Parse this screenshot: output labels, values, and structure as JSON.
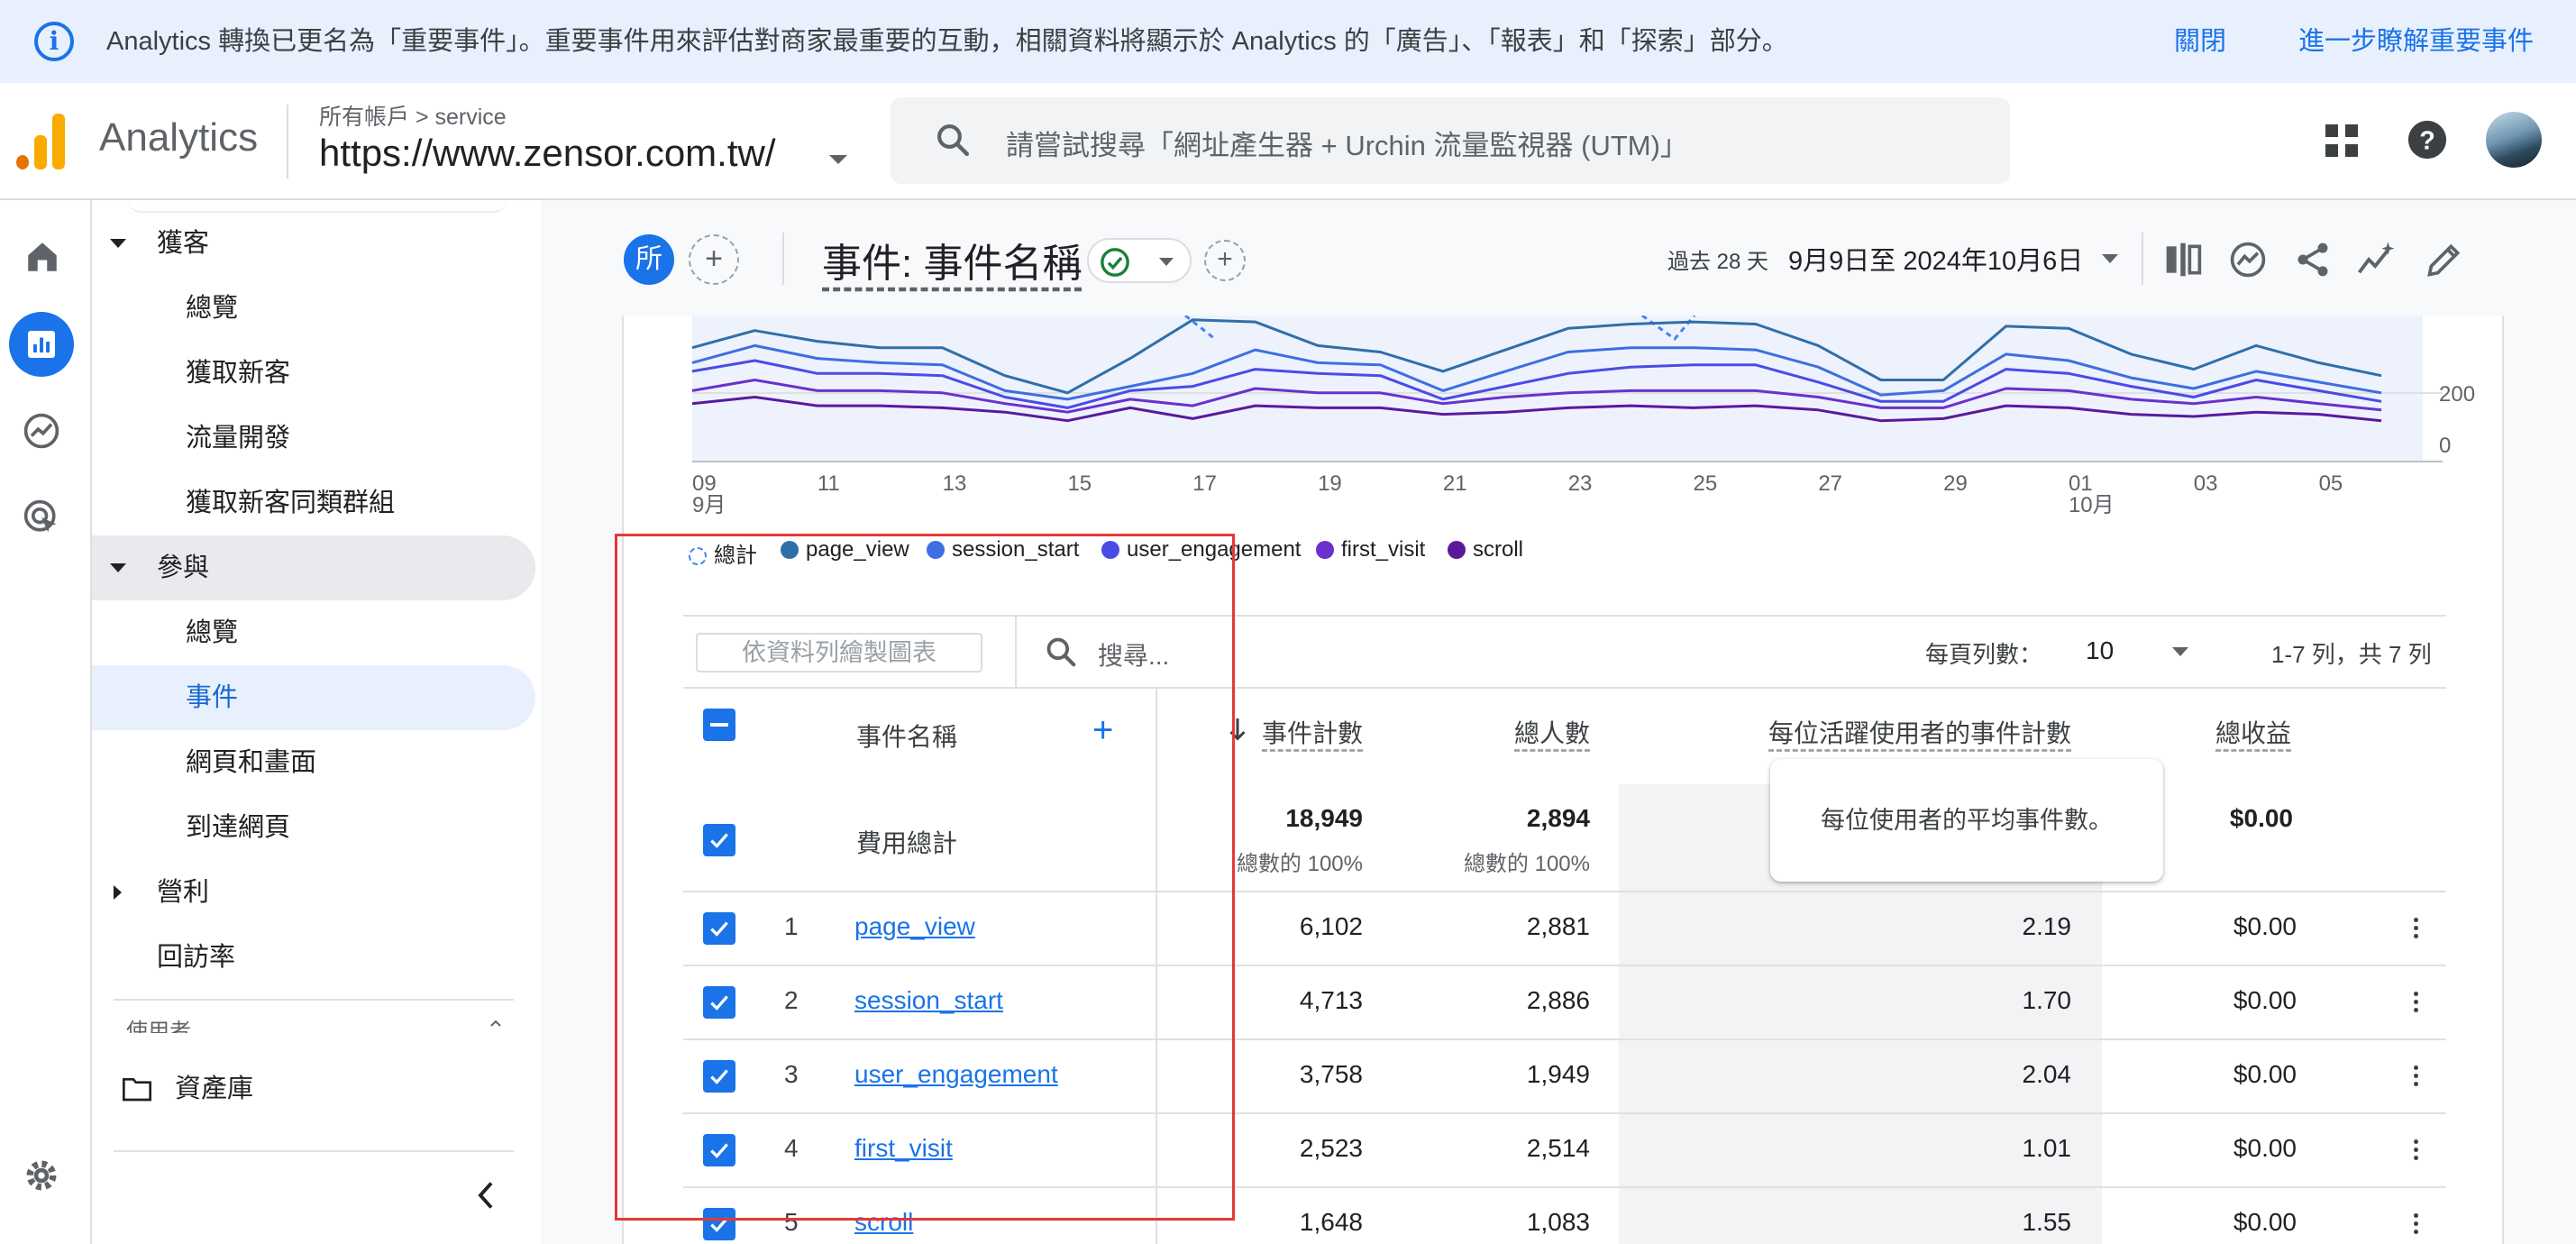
{
  "banner": {
    "message": "Analytics 轉換已更名為「重要事件」。重要事件用來評估對商家最重要的互動，相關資料將顯示於 Analytics 的「廣告」、「報表」和「探索」部分。",
    "close": "關閉",
    "learn_more": "進一步瞭解重要事件"
  },
  "header": {
    "app_name": "Analytics",
    "breadcrumb": "所有帳戶 > service",
    "property": "https://www.zensor.com.tw/",
    "search_placeholder": "請嘗試搜尋「網址產生器 + Urchin 流量監視器 (UTM)」"
  },
  "nav": {
    "acquisition": {
      "label": "獲客",
      "items": [
        "總覽",
        "獲取新客",
        "流量開發",
        "獲取新客同類群組"
      ]
    },
    "engagement": {
      "label": "參與",
      "items": [
        "總覽",
        "事件",
        "網頁和畫面",
        "到達網頁"
      ]
    },
    "monetization": "營利",
    "retention": "回訪率",
    "user_section": "使用者",
    "library": "資產庫"
  },
  "toolbar": {
    "avatar_letter": "所",
    "title": "事件: 事件名稱",
    "date_prefix": "過去 28 天",
    "date_range": "9月9日至 2024年10月6日"
  },
  "chart_data": {
    "type": "line",
    "x": [
      "09/09",
      "09/10",
      "09/11",
      "09/12",
      "09/13",
      "09/14",
      "09/15",
      "09/16",
      "09/17",
      "09/18",
      "09/19",
      "09/20",
      "09/21",
      "09/22",
      "09/23",
      "09/24",
      "09/25",
      "09/26",
      "09/27",
      "09/28",
      "09/29",
      "09/30",
      "10/01",
      "10/02",
      "10/03",
      "10/04",
      "10/05",
      "10/06"
    ],
    "x_tick_labels": [
      "09",
      "11",
      "13",
      "15",
      "17",
      "19",
      "21",
      "23",
      "25",
      "27",
      "29",
      "01",
      "03",
      "05"
    ],
    "x_month_labels": [
      "9月",
      "10月"
    ],
    "y_tick_labels": [
      "0",
      "200"
    ],
    "series": [
      {
        "name": "page_view",
        "color": "#2f6fa8",
        "values": [
          265,
          305,
          280,
          265,
          265,
          200,
          160,
          240,
          330,
          325,
          270,
          255,
          210,
          260,
          310,
          320,
          325,
          320,
          270,
          190,
          190,
          315,
          310,
          250,
          215,
          270,
          230,
          200
        ]
      },
      {
        "name": "session_start",
        "color": "#3d6fe0",
        "values": [
          230,
          270,
          240,
          230,
          225,
          165,
          145,
          175,
          205,
          260,
          230,
          225,
          165,
          210,
          255,
          265,
          265,
          260,
          220,
          155,
          165,
          250,
          235,
          195,
          170,
          210,
          185,
          160
        ]
      },
      {
        "name": "user_engagement",
        "color": "#4a4ce6",
        "values": [
          210,
          235,
          205,
          205,
          200,
          150,
          125,
          165,
          175,
          215,
          205,
          200,
          145,
          175,
          205,
          220,
          225,
          225,
          185,
          140,
          140,
          215,
          205,
          175,
          150,
          190,
          165,
          140
        ]
      },
      {
        "name": "first_visit",
        "color": "#6a31cc",
        "values": [
          165,
          190,
          165,
          165,
          160,
          135,
          115,
          145,
          130,
          170,
          160,
          160,
          135,
          150,
          160,
          165,
          165,
          165,
          150,
          125,
          125,
          170,
          165,
          145,
          135,
          150,
          135,
          120
        ]
      },
      {
        "name": "scroll",
        "color": "#5b1a9c",
        "values": [
          135,
          150,
          130,
          130,
          125,
          115,
          95,
          125,
          100,
          130,
          125,
          125,
          110,
          115,
          125,
          130,
          125,
          130,
          120,
          95,
          100,
          130,
          125,
          110,
          105,
          115,
          110,
          95
        ]
      }
    ]
  },
  "legend": [
    {
      "label": "總計",
      "color": "#4285f4",
      "style": "dashed"
    },
    {
      "label": "page_view",
      "color": "#2f6fa8"
    },
    {
      "label": "session_start",
      "color": "#3d6fe0"
    },
    {
      "label": "user_engagement",
      "color": "#4a4ce6"
    },
    {
      "label": "first_visit",
      "color": "#6a31cc"
    },
    {
      "label": "scroll",
      "color": "#5b1a9c"
    }
  ],
  "table": {
    "plot_rows_placeholder": "依資料列繪製圖表",
    "search_placeholder": "搜尋...",
    "rows_per_page_label": "每頁列數：",
    "rows_per_page": "10",
    "pagination": "1-7 列，共 7 列",
    "columns": [
      "事件名稱",
      "事件計數",
      "總人數",
      "每位活躍使用者的事件計數",
      "總收益"
    ],
    "tooltip": "每位使用者的平均事件數。",
    "totals": {
      "label": "費用總計",
      "event_count": "18,949",
      "event_count_sub": "總數的 100%",
      "total_users": "2,894",
      "total_users_sub": "總數的 100%",
      "revenue": "$0.00"
    },
    "rows": [
      {
        "idx": "1",
        "name": "page_view",
        "event_count": "6,102",
        "total_users": "2,881",
        "per_user": "2.19",
        "revenue": "$0.00"
      },
      {
        "idx": "2",
        "name": "session_start",
        "event_count": "4,713",
        "total_users": "2,886",
        "per_user": "1.70",
        "revenue": "$0.00"
      },
      {
        "idx": "3",
        "name": "user_engagement",
        "event_count": "3,758",
        "total_users": "1,949",
        "per_user": "2.04",
        "revenue": "$0.00"
      },
      {
        "idx": "4",
        "name": "first_visit",
        "event_count": "2,523",
        "total_users": "2,514",
        "per_user": "1.01",
        "revenue": "$0.00"
      },
      {
        "idx": "5",
        "name": "scroll",
        "event_count": "1,648",
        "total_users": "1,083",
        "per_user": "1.55",
        "revenue": "$0.00"
      }
    ]
  }
}
